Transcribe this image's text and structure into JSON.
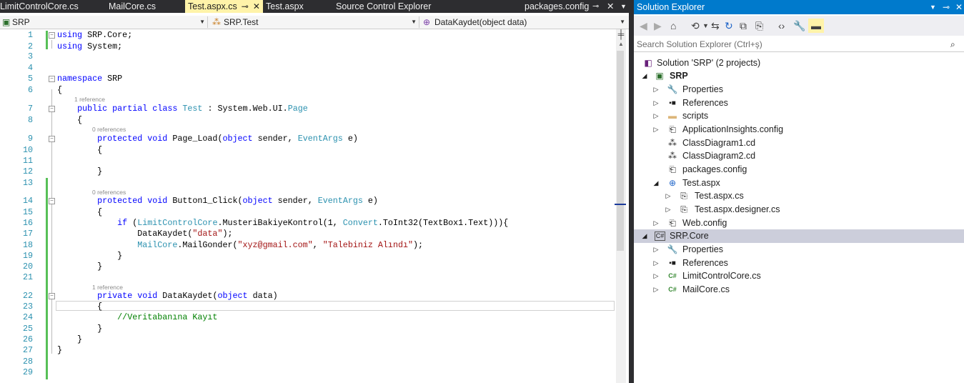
{
  "tabs": {
    "t1": "LimitControlCore.cs",
    "t2": "MailCore.cs",
    "t3": "Test.aspx.cs",
    "t4": "Test.aspx",
    "t5": "Source Control Explorer",
    "t6": "packages.config"
  },
  "navbar": {
    "project": "SRP",
    "class": "SRP.Test",
    "member": "DataKaydet(object data)"
  },
  "code": {
    "lens": {
      "l7": "1 reference",
      "l9": "0 references",
      "l14": "0 references",
      "l22": "1 reference"
    },
    "strings": {
      "data": "\"data\"",
      "mail": "\"xyz@gmail.com\"",
      "talep": "\"Talebiniz Alındı\"",
      "comment": "//Veritabanına Kayıt"
    }
  },
  "solution_explorer": {
    "title": "Solution Explorer",
    "search_placeholder": "Search Solution Explorer (Ctrl+ş)",
    "tree": {
      "solution": "Solution 'SRP' (2 projects)",
      "srp": "SRP",
      "properties": "Properties",
      "references": "References",
      "scripts": "scripts",
      "appinsights": "ApplicationInsights.config",
      "classdiagram1": "ClassDiagram1.cd",
      "classdiagram2": "ClassDiagram2.cd",
      "packages": "packages.config",
      "testaspx": "Test.aspx",
      "testaspxcs": "Test.aspx.cs",
      "testdesigner": "Test.aspx.designer.cs",
      "webconfig": "Web.config",
      "srpcore": "SRP.Core",
      "properties2": "Properties",
      "references2": "References",
      "limitcontrol": "LimitControlCore.cs",
      "mailcore": "MailCore.cs"
    }
  },
  "colors": {
    "accent": "#007acc",
    "tab_active": "#fff3a9",
    "change_bar": "#57c057"
  }
}
